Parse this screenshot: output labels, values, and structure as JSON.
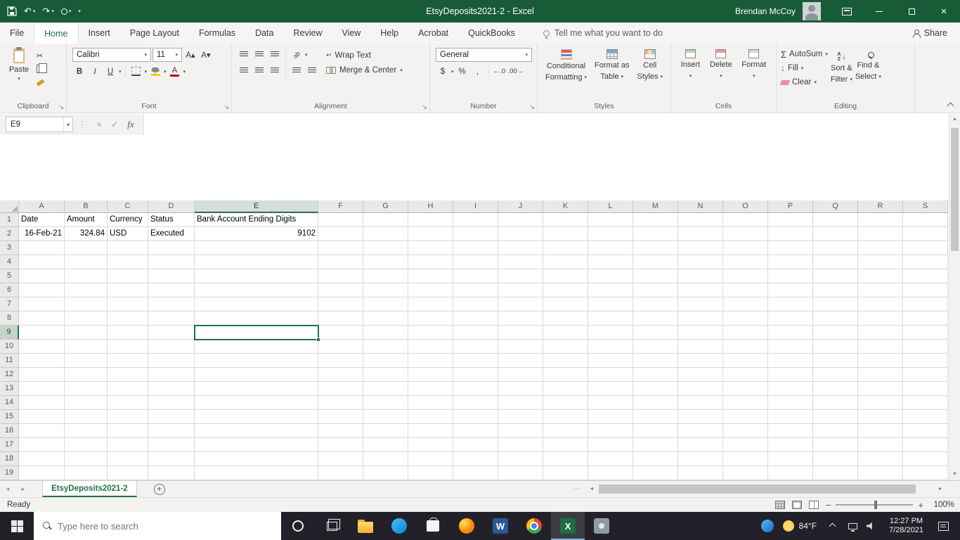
{
  "colors": {
    "excel_green": "#217346",
    "titlebar_green": "#185C37",
    "selection_border": "#217346",
    "taskbar_bg": "#222129"
  },
  "titlebar": {
    "title": "EtsyDeposits2021-2  -  Excel",
    "user_name": "Brendan McCoy"
  },
  "tabs": {
    "items": [
      "File",
      "Home",
      "Insert",
      "Page Layout",
      "Formulas",
      "Data",
      "Review",
      "View",
      "Help",
      "Acrobat",
      "QuickBooks"
    ],
    "active": "Home",
    "tell_me": "Tell me what you want to do",
    "share": "Share"
  },
  "ribbon": {
    "clipboard": {
      "group": "Clipboard",
      "paste": "Paste"
    },
    "font": {
      "group": "Font",
      "name": "Calibri",
      "size": "11"
    },
    "alignment": {
      "group": "Alignment",
      "wrap": "Wrap Text",
      "merge": "Merge & Center"
    },
    "number": {
      "group": "Number",
      "format": "General"
    },
    "styles": {
      "group": "Styles",
      "conditional_1": "Conditional",
      "conditional_2": "Formatting",
      "table_1": "Format as",
      "table_2": "Table",
      "cellstyles_1": "Cell",
      "cellstyles_2": "Styles"
    },
    "cells": {
      "group": "Cells",
      "insert": "Insert",
      "delete": "Delete",
      "format": "Format"
    },
    "editing": {
      "group": "Editing",
      "autosum": "AutoSum",
      "fill": "Fill",
      "clear": "Clear",
      "sort_1": "Sort &",
      "sort_2": "Filter",
      "find_1": "Find &",
      "find_2": "Select"
    }
  },
  "formula_bar": {
    "name_box": "E9",
    "fx": "fx",
    "formula": ""
  },
  "grid": {
    "columns": [
      "A",
      "B",
      "C",
      "D",
      "E",
      "F",
      "G",
      "H",
      "I",
      "J",
      "K",
      "L",
      "M",
      "N",
      "O",
      "P",
      "Q",
      "R",
      "S"
    ],
    "row_count": 19,
    "selected_cell": {
      "col": "E",
      "row": 9
    },
    "data": [
      {
        "row": 1,
        "cells": [
          {
            "col": "A",
            "text": "Date",
            "align": "left"
          },
          {
            "col": "B",
            "text": "Amount",
            "align": "left"
          },
          {
            "col": "C",
            "text": "Currency",
            "align": "left"
          },
          {
            "col": "D",
            "text": "Status",
            "align": "left"
          },
          {
            "col": "E",
            "text": "Bank Account Ending Digits",
            "align": "left"
          }
        ]
      },
      {
        "row": 2,
        "cells": [
          {
            "col": "A",
            "text": "16-Feb-21",
            "align": "right"
          },
          {
            "col": "B",
            "text": "324.84",
            "align": "right"
          },
          {
            "col": "C",
            "text": "USD",
            "align": "left"
          },
          {
            "col": "D",
            "text": "Executed",
            "align": "left"
          },
          {
            "col": "E",
            "text": "9102",
            "align": "right"
          }
        ]
      }
    ]
  },
  "sheet_tabs": {
    "active": "EtsyDeposits2021-2"
  },
  "status_bar": {
    "mode": "Ready",
    "zoom_level": "100%"
  },
  "taskbar": {
    "search_placeholder": "Type here to search",
    "weather_temp": "84°F",
    "time": "12:27 PM",
    "date": "7/28/2021",
    "pinned_apps": [
      {
        "name": "file-explorer"
      },
      {
        "name": "edge"
      },
      {
        "name": "microsoft-store"
      },
      {
        "name": "firefox"
      },
      {
        "name": "word",
        "letter": "W"
      },
      {
        "name": "chrome"
      },
      {
        "name": "excel",
        "letter": "X",
        "active": true
      },
      {
        "name": "paint"
      }
    ]
  },
  "icons": {
    "dropdown": "▾",
    "launcher": "↘",
    "undo": "↶",
    "redo": "↷",
    "cut": "✂",
    "bold": "B",
    "italic": "I",
    "underline": "U",
    "font_increase": "A▴",
    "font_decrease": "A▾",
    "font_color_letter": "A",
    "orientation": "ab",
    "wrap_arrow": "↩",
    "currency": "$",
    "percent": "%",
    "comma": ",",
    "increase_decimal": "←.0",
    "decrease_decimal": ".00→",
    "sigma": "Σ",
    "fill_arrow": "↓",
    "sort_a": "A",
    "sort_z": "Z",
    "sort_arrow": "↓",
    "check": "✓",
    "cancel": "×",
    "dots": "⋮",
    "nav_left": "◄",
    "nav_right": "►",
    "scroll_up": "▲",
    "scroll_down": "▼",
    "splitter": "⋯",
    "add_sheet": "+",
    "zoom_out": "−",
    "zoom_in": "+",
    "close": "×"
  }
}
